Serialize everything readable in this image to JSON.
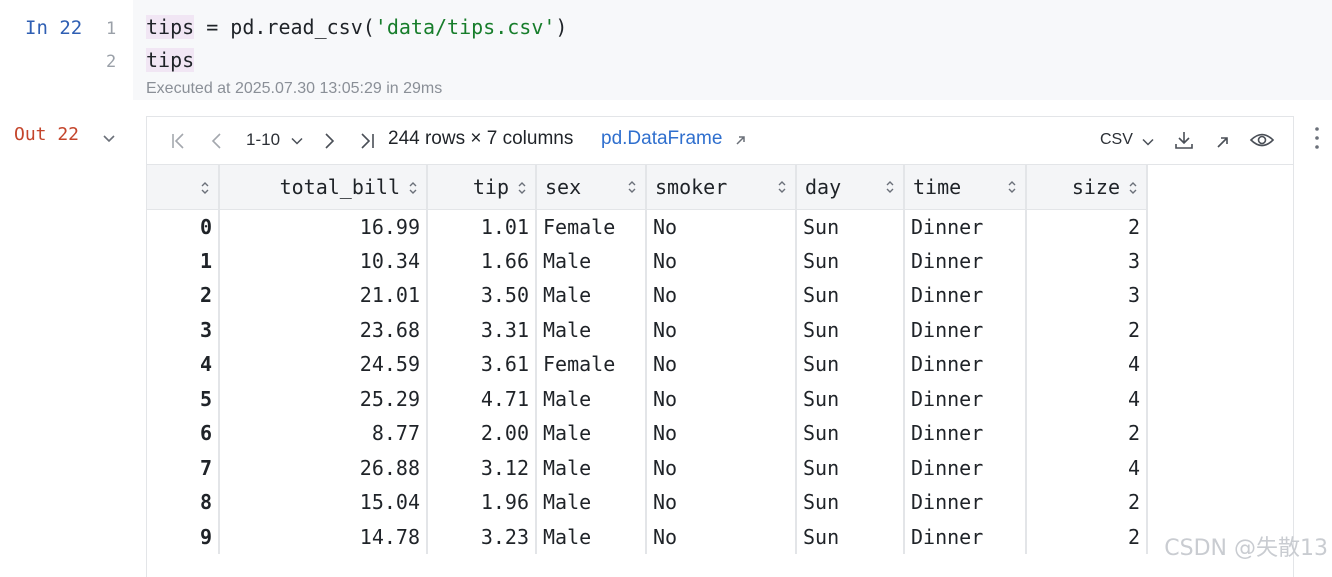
{
  "input_cell": {
    "label": "In 22",
    "lines": [
      {
        "num": "1",
        "var": "tips",
        "mid": " = pd.read_csv(",
        "str": "'data/tips.csv'",
        "end": ")"
      },
      {
        "num": "2",
        "var": "tips"
      }
    ],
    "exec_info": "Executed at 2025.07.30 13:05:29 in 29ms"
  },
  "output_cell": {
    "label": "Out 22",
    "toolbar": {
      "range": "1-10",
      "rows_info": "244 rows × 7 columns",
      "df_link": "pd.DataFrame",
      "export_format": "CSV",
      "icons": [
        "first-page-icon",
        "prev-page-icon",
        "next-page-icon",
        "last-page-icon",
        "download-icon",
        "open-external-icon",
        "eye-icon"
      ]
    },
    "table": {
      "columns": [
        "",
        "total_bill",
        "tip",
        "sex",
        "smoker",
        "day",
        "time",
        "size"
      ],
      "rows": [
        [
          "0",
          "16.99",
          "1.01",
          "Female",
          "No",
          "Sun",
          "Dinner",
          "2"
        ],
        [
          "1",
          "10.34",
          "1.66",
          "Male",
          "No",
          "Sun",
          "Dinner",
          "3"
        ],
        [
          "2",
          "21.01",
          "3.50",
          "Male",
          "No",
          "Sun",
          "Dinner",
          "3"
        ],
        [
          "3",
          "23.68",
          "3.31",
          "Male",
          "No",
          "Sun",
          "Dinner",
          "2"
        ],
        [
          "4",
          "24.59",
          "3.61",
          "Female",
          "No",
          "Sun",
          "Dinner",
          "4"
        ],
        [
          "5",
          "25.29",
          "4.71",
          "Male",
          "No",
          "Sun",
          "Dinner",
          "4"
        ],
        [
          "6",
          "8.77",
          "2.00",
          "Male",
          "No",
          "Sun",
          "Dinner",
          "2"
        ],
        [
          "7",
          "26.88",
          "3.12",
          "Male",
          "No",
          "Sun",
          "Dinner",
          "4"
        ],
        [
          "8",
          "15.04",
          "1.96",
          "Male",
          "No",
          "Sun",
          "Dinner",
          "2"
        ],
        [
          "9",
          "14.78",
          "3.23",
          "Male",
          "No",
          "Sun",
          "Dinner",
          "2"
        ]
      ]
    }
  },
  "watermark": "CSDN @失散13",
  "colors": {
    "link": "#2f6fce",
    "in_label": "#2f5fb3",
    "out_label": "#c4452b",
    "string": "#177d2b"
  }
}
